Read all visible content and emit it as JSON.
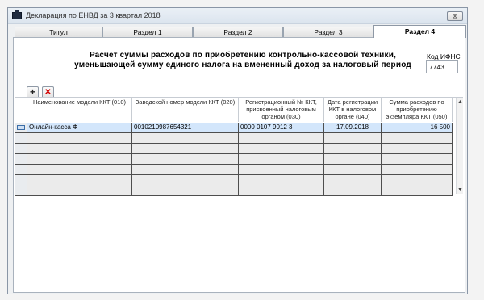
{
  "window": {
    "title": "Декларация по ЕНВД за 3 квартал 2018",
    "close_glyph": "⊠"
  },
  "tabs": [
    {
      "label": "Титул"
    },
    {
      "label": "Раздел 1"
    },
    {
      "label": "Раздел 2"
    },
    {
      "label": "Раздел 3"
    },
    {
      "label": "Раздел 4",
      "active": true
    }
  ],
  "section": {
    "heading_line1": "Расчет суммы расходов по приобретению контрольно-кассовой техники,",
    "heading_line2": "уменьшающей сумму единого налога на вмененный доход за налоговый период",
    "ifns_label": "Код ИФНС",
    "ifns_value": "7743"
  },
  "toolbar": {
    "add_glyph": "+",
    "delete_glyph": "✕"
  },
  "grid": {
    "columns": [
      "Наименование модели ККТ (010)",
      "Заводской номер модели ККТ (020)",
      "Регистрационный № ККТ, присвоенный налоговым органом (030)",
      "Дата регистрации ККТ в налоговом органе (040)",
      "Сумма расходов по приобретению экземпляра ККТ (050)"
    ],
    "rows": [
      [
        "Онлайн-касса Ф",
        "0010210987654321",
        "0000 0107 9012 3",
        "17.09.2018",
        "16 500"
      ]
    ],
    "scroll_up": "▲",
    "scroll_down": "▼"
  }
}
